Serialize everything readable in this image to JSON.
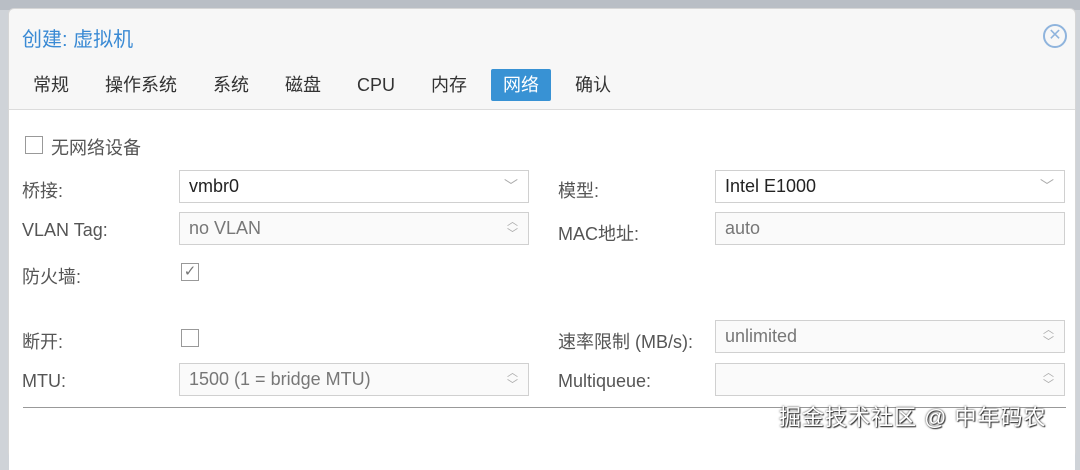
{
  "dialog": {
    "title": "创建: 虚拟机"
  },
  "tabs": [
    "常规",
    "操作系统",
    "系统",
    "磁盘",
    "CPU",
    "内存",
    "网络",
    "确认"
  ],
  "active_tab": 6,
  "form": {
    "no_network": "无网络设备",
    "bridge_label": "桥接:",
    "bridge_value": "vmbr0",
    "model_label": "模型:",
    "model_value": "Intel E1000",
    "vlan_label": "VLAN Tag:",
    "vlan_value": "no VLAN",
    "mac_label": "MAC地址:",
    "mac_value": "auto",
    "firewall_label": "防火墙:",
    "disconnect_label": "断开:",
    "rate_label": "速率限制 (MB/s):",
    "rate_value": "unlimited",
    "mtu_label": "MTU:",
    "mtu_value": "1500 (1 = bridge MTU)",
    "multiqueue_label": "Multiqueue:",
    "multiqueue_value": ""
  },
  "watermark": "掘金技术社区 @ 中年码农"
}
